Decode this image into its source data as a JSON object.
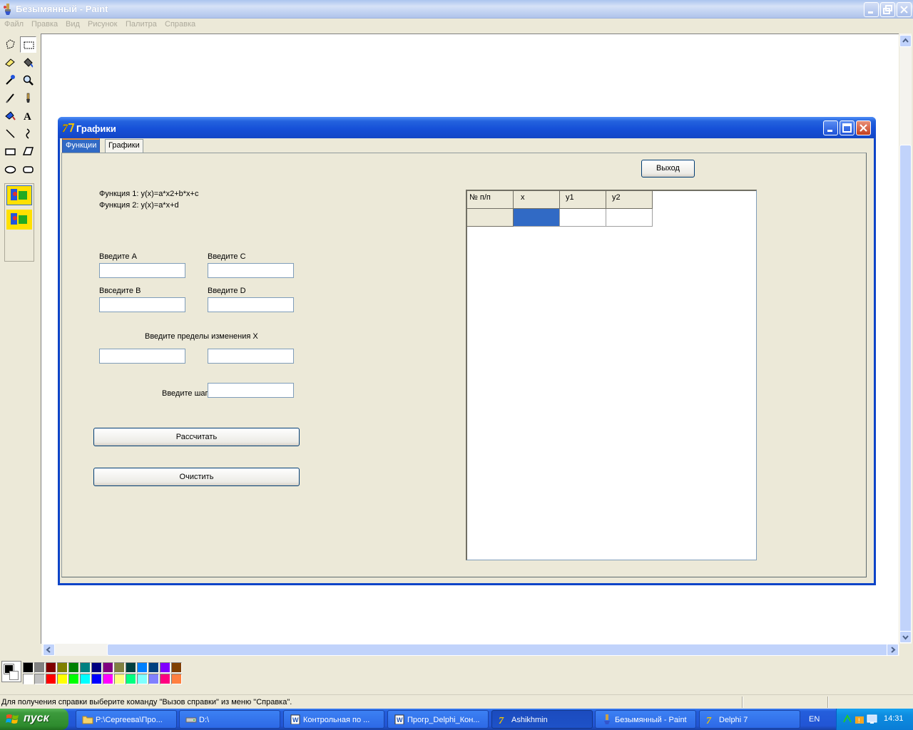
{
  "paint": {
    "title": "Безымянный - Paint",
    "menu": [
      "Файл",
      "Правка",
      "Вид",
      "Рисунок",
      "Палитра",
      "Справка"
    ],
    "tools": [
      "free-select",
      "rect-select",
      "eraser",
      "fill",
      "color-picker",
      "magnifier",
      "pencil",
      "brush",
      "airbrush",
      "text",
      "line",
      "curve",
      "rectangle",
      "polygon",
      "ellipse",
      "rounded-rectangle"
    ],
    "palette": [
      "#000000",
      "#808080",
      "#800000",
      "#808000",
      "#008000",
      "#008080",
      "#000080",
      "#800080",
      "#808040",
      "#004040",
      "#0080FF",
      "#004080",
      "#8000FF",
      "#804000",
      "#FFFFFF",
      "#C0C0C0",
      "#FF0000",
      "#FFFF00",
      "#00FF00",
      "#00FFFF",
      "#0000FF",
      "#FF00FF",
      "#FFFF80",
      "#00FF80",
      "#80FFFF",
      "#8080FF",
      "#FF0080",
      "#FF8040"
    ],
    "status_text": "Для получения справки выберите команду \"Вызов справки\" из меню \"Справка\"."
  },
  "form": {
    "title": "Графики",
    "tabs": [
      "Функции",
      "Графики"
    ],
    "func1": "Функция 1: y(x)=a*x2+b*x+c",
    "func2": "Функция 2: y(x)=a*x+d",
    "label_a": "Введите A",
    "label_b": "Ввседите B",
    "label_c": "Введите C",
    "label_d": "Введите D",
    "label_limits": "Введите пределы изменения X",
    "label_step": "Введите шаг",
    "calc_button": "Рассчитать",
    "clear_button": "Очистить",
    "exit_button": "Выход",
    "grid": {
      "headers": [
        "№ п/п",
        "x",
        "y1",
        "y2"
      ],
      "rows": [
        [
          "",
          "",
          "",
          ""
        ]
      ]
    }
  },
  "taskbar": {
    "start_label": "пуск",
    "items": [
      "P:\\Сергеева\\Про...",
      "D:\\",
      "Контрольная по ...",
      "Прогр_Delphi_Кон...",
      "Ashikhmin",
      "Безымянный - Paint",
      "Delphi 7"
    ],
    "language": "EN",
    "clock": "14:31"
  }
}
